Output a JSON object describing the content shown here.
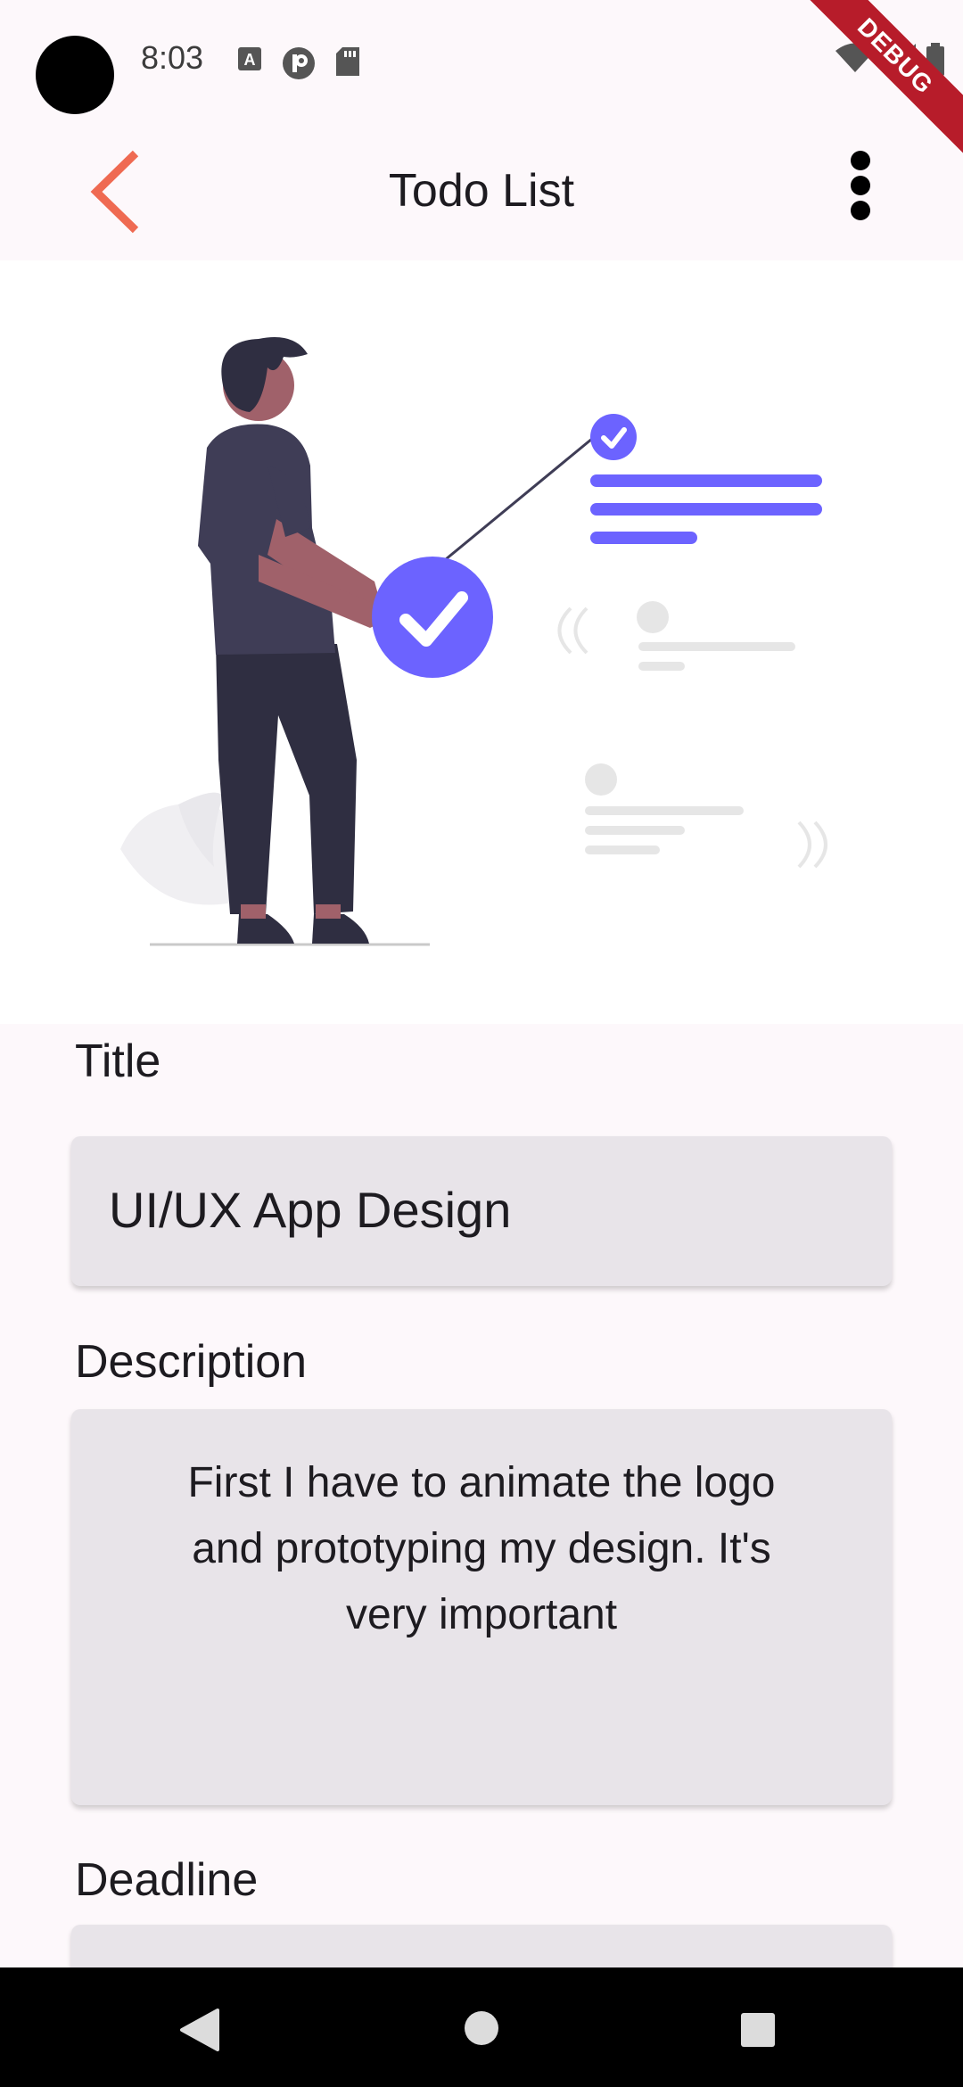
{
  "status_bar": {
    "time": "8:03",
    "icons_left": [
      "a-icon",
      "p-icon",
      "sd-card-icon"
    ],
    "icons_right": [
      "wifi-icon",
      "signal-icon",
      "battery-icon"
    ],
    "debug_banner": "DEBUG",
    "debug_color": "#b71c2a"
  },
  "app_bar": {
    "title": "Todo List",
    "back_icon": "chevron-left-icon",
    "menu_icon": "more-vertical-icon",
    "accent_color": "#ef6a52"
  },
  "illustration": {
    "accent_color": "#6c63ff",
    "subject": "person-checking-task-illustration"
  },
  "form": {
    "title_label": "Title",
    "title_value": "UI/UX App Design",
    "description_label": "Description",
    "description_value": "First I have to animate the logo\nand prototyping my design. It's\nvery important",
    "deadline_label": "Deadline"
  },
  "nav_bar": {
    "buttons": [
      "back-triangle-icon",
      "home-circle-icon",
      "recents-square-icon"
    ]
  }
}
